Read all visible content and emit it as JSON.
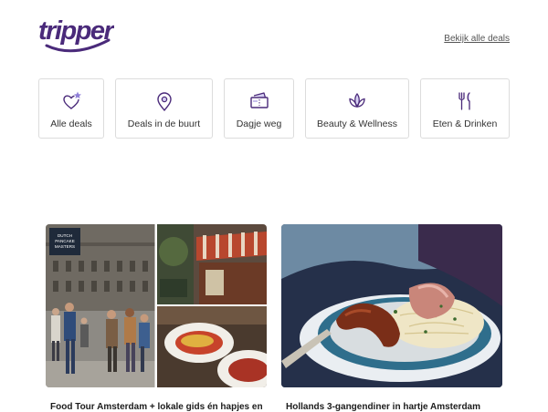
{
  "header": {
    "logo_text": "tripper",
    "all_deals_link": "Bekijk alle deals"
  },
  "categories": [
    {
      "label": "Alle deals",
      "icon": "heart-star-icon"
    },
    {
      "label": "Deals in de buurt",
      "icon": "location-pin-icon"
    },
    {
      "label": "Dagje weg",
      "icon": "tickets-icon"
    },
    {
      "label": "Beauty & Wellness",
      "icon": "lotus-icon"
    },
    {
      "label": "Eten & Drinken",
      "icon": "cutlery-icon"
    }
  ],
  "deals": [
    {
      "title": "Food Tour Amsterdam + lokale gids én hapjes en",
      "badge": "DUTCH PANCAKE MASTERS",
      "image": "food-tour-collage"
    },
    {
      "title": "Hollands 3-gangendiner in hartje Amsterdam",
      "image": "sausage-sauerkraut-plate"
    }
  ],
  "colors": {
    "brand": "#4a2a7a",
    "icon_accent": "#8f7fd8",
    "border": "#dcdcdc"
  }
}
